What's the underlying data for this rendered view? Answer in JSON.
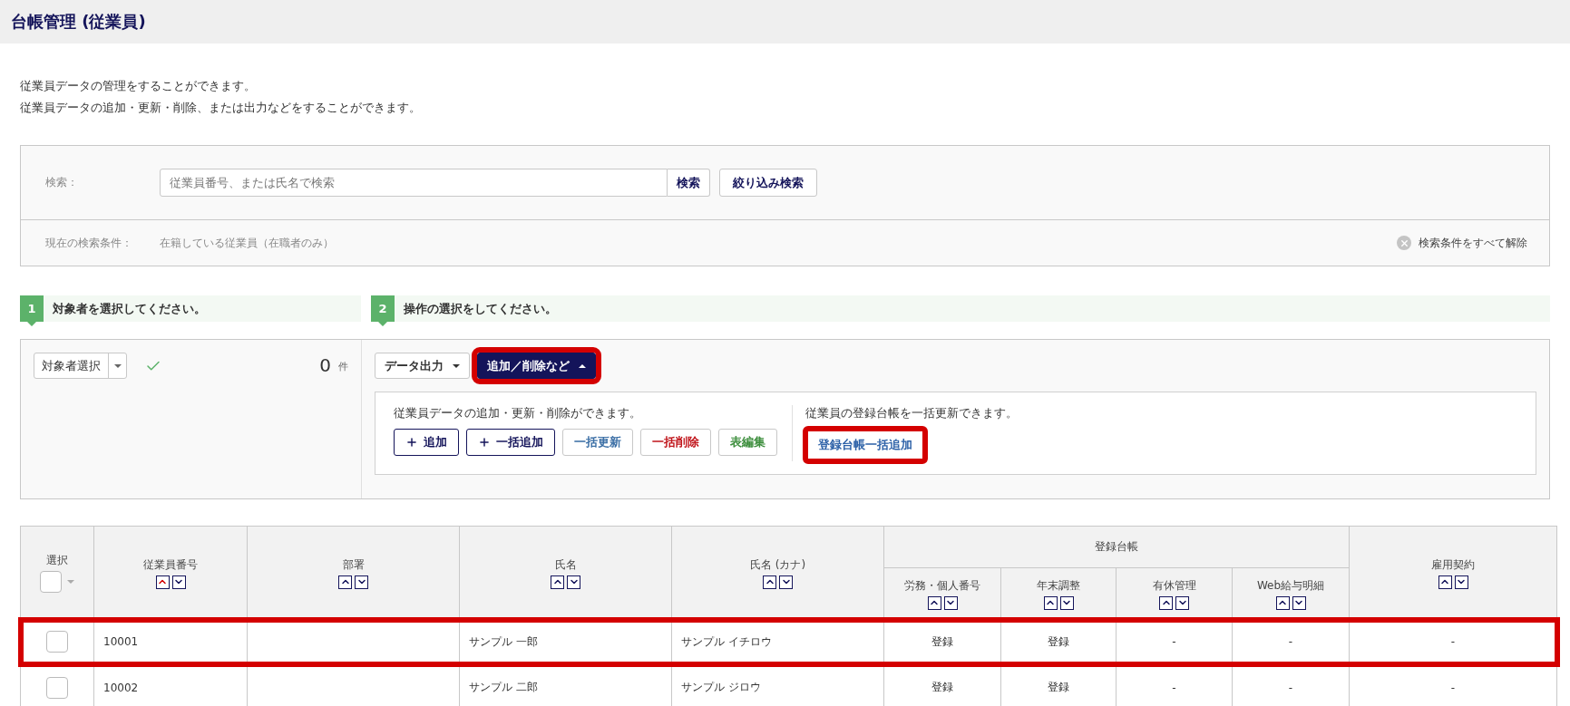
{
  "page_title": "台帳管理 (従業員)",
  "description": [
    "従業員データの管理をすることができます。",
    "従業員データの追加・更新・削除、または出力などをすることができます。"
  ],
  "search": {
    "label": "検索：",
    "placeholder": "従業員番号、または氏名で検索",
    "search_button": "検索",
    "filter_button": "絞り込み検索",
    "conditions_label": "現在の検索条件：",
    "conditions_value": "在籍している従業員（在職者のみ）",
    "clear_all": "検索条件をすべて解除"
  },
  "steps": [
    {
      "number": "1",
      "label": "対象者を選択してください。"
    },
    {
      "number": "2",
      "label": "操作の選択をしてください。"
    }
  ],
  "target": {
    "select": "対象者選択",
    "count": "0",
    "unit": "件"
  },
  "operations": {
    "menus": [
      {
        "label": "データ出力",
        "expanded": false,
        "highlighted": false
      },
      {
        "label": "追加／削除など",
        "expanded": true,
        "highlighted": true
      }
    ],
    "groups": [
      {
        "description": "従業員データの追加・更新・削除ができます。",
        "buttons": [
          {
            "label": "追加",
            "kind": "add",
            "highlighted": false
          },
          {
            "label": "一括追加",
            "kind": "add",
            "highlighted": false
          },
          {
            "label": "一括更新",
            "kind": "update",
            "highlighted": false
          },
          {
            "label": "一括削除",
            "kind": "delete",
            "highlighted": false
          },
          {
            "label": "表編集",
            "kind": "edit",
            "highlighted": false
          }
        ]
      },
      {
        "description": "従業員の登録台帳を一括更新できます。",
        "buttons": [
          {
            "label": "登録台帳一括追加",
            "kind": "link",
            "highlighted": true
          }
        ]
      }
    ]
  },
  "table": {
    "columns": [
      {
        "kind": "select",
        "label": "選択",
        "checked": false
      },
      {
        "kind": "sortable",
        "label": "従業員番号",
        "sorted_ascending": true
      },
      {
        "kind": "sortable",
        "label": "部署",
        "sorted_ascending": false
      },
      {
        "kind": "sortable",
        "label": "氏名",
        "sorted_ascending": false
      },
      {
        "kind": "sortable",
        "label": "氏名 (カナ)",
        "sorted_ascending": false
      },
      {
        "kind": "group",
        "label": "登録台帳",
        "children": [
          {
            "label": "労務・個人番号",
            "sorted_ascending": false
          },
          {
            "label": "年末調整",
            "sorted_ascending": false
          },
          {
            "label": "有休管理",
            "sorted_ascending": false
          },
          {
            "label": "Web給与明細",
            "sorted_ascending": false
          }
        ]
      },
      {
        "kind": "sortable",
        "label": "雇用契約",
        "sorted_ascending": false
      }
    ],
    "rows": [
      {
        "selected": false,
        "highlighted": true,
        "cells": {
          "employee_no": "10001",
          "name": "サンプル 一郎",
          "kana": "サンプル イチロウ",
          "labor": "登録",
          "year_end": "登録",
          "paid_leave": "-",
          "web_payslip": "-",
          "contract": "-"
        }
      },
      {
        "selected": false,
        "highlighted": false,
        "cells": {
          "employee_no": "10002",
          "name": "サンプル 二郎",
          "kana": "サンプル ジロウ",
          "labor": "登録",
          "year_end": "登録",
          "paid_leave": "-",
          "web_payslip": "-",
          "contract": "-"
        }
      }
    ]
  }
}
